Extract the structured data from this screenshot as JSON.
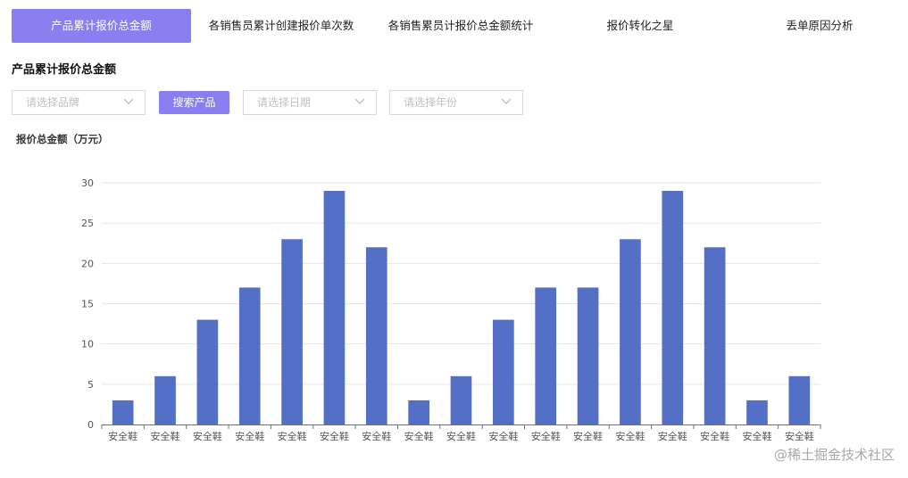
{
  "tabs": [
    {
      "label": "产品累计报价总金额",
      "active": true
    },
    {
      "label": "各销售员累计创建报价单次数",
      "active": false
    },
    {
      "label": "各销售累员计报价总金额统计",
      "active": false
    },
    {
      "label": "报价转化之星",
      "active": false
    },
    {
      "label": "丢单原因分析",
      "active": false
    }
  ],
  "section_title": "产品累计报价总金额",
  "filters": {
    "brand_placeholder": "请选择品牌",
    "search_button": "搜索产品",
    "date_placeholder": "请选择日期",
    "year_placeholder": "请选择年份"
  },
  "colors": {
    "accent": "#8a7ef0",
    "bar": "#5470c6"
  },
  "watermark": "@稀土掘金技术社区",
  "chart_data": {
    "type": "bar",
    "ylabel": "报价总金额（万元）",
    "xlabel": "",
    "ylim": [
      0,
      30
    ],
    "yticks": [
      0,
      5,
      10,
      15,
      20,
      25,
      30
    ],
    "grid": true,
    "categories": [
      "安全鞋",
      "安全鞋",
      "安全鞋",
      "安全鞋",
      "安全鞋",
      "安全鞋",
      "安全鞋",
      "安全鞋",
      "安全鞋",
      "安全鞋",
      "安全鞋",
      "安全鞋",
      "安全鞋",
      "安全鞋",
      "安全鞋",
      "安全鞋",
      "安全鞋"
    ],
    "values": [
      3,
      6,
      13,
      17,
      23,
      29,
      22,
      3,
      6,
      13,
      17,
      17,
      23,
      29,
      22,
      3,
      6
    ]
  }
}
